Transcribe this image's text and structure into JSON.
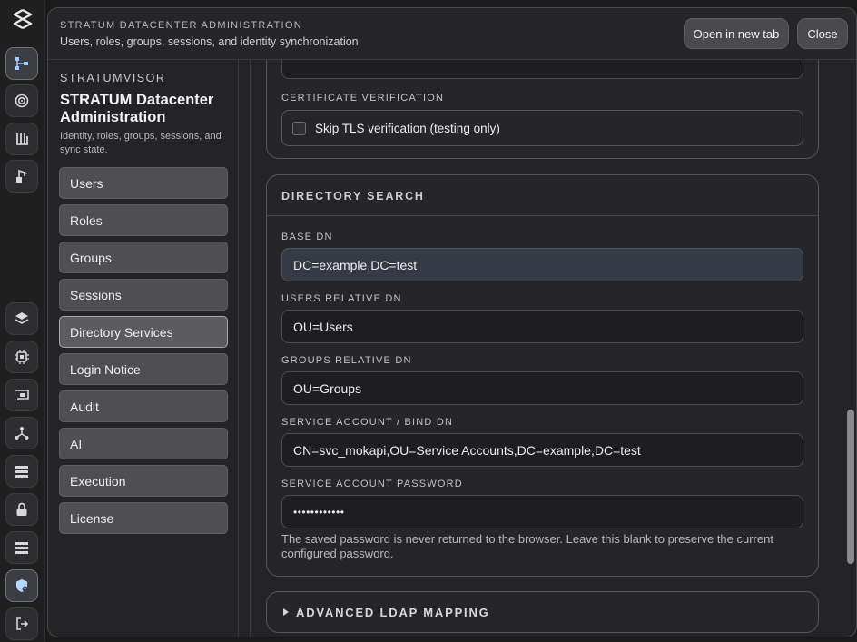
{
  "header": {
    "eyebrow": "STRATUM DATACENTER ADMINISTRATION",
    "subtitle": "Users, roles, groups, sessions, and identity synchronization",
    "open_new_tab_label": "Open in new tab",
    "close_label": "Close"
  },
  "sidebar": {
    "brand": "STRATUMVISOR",
    "title": "STRATUM Datacenter Administration",
    "description": "Identity, roles, groups, sessions, and sync state.",
    "items": [
      {
        "label": "Users"
      },
      {
        "label": "Roles"
      },
      {
        "label": "Groups"
      },
      {
        "label": "Sessions"
      },
      {
        "label": "Directory Services"
      },
      {
        "label": "Login Notice"
      },
      {
        "label": "Audit"
      },
      {
        "label": "AI"
      },
      {
        "label": "Execution"
      },
      {
        "label": "License"
      }
    ],
    "active_item": "Directory Services"
  },
  "certificate": {
    "label": "CERTIFICATE VERIFICATION",
    "skip_tls_label": "Skip TLS verification (testing only)",
    "skip_tls_checked": false
  },
  "directory_search": {
    "title": "DIRECTORY SEARCH",
    "base_dn_label": "BASE DN",
    "base_dn_value": "DC=example,DC=test",
    "users_dn_label": "USERS RELATIVE DN",
    "users_dn_value": "OU=Users",
    "groups_dn_label": "GROUPS RELATIVE DN",
    "groups_dn_value": "OU=Groups",
    "bind_dn_label": "SERVICE ACCOUNT / BIND DN",
    "bind_dn_value": "CN=svc_mokapi,OU=Service Accounts,DC=example,DC=test",
    "password_label": "SERVICE ACCOUNT PASSWORD",
    "password_value": "••••••••••••",
    "password_hint": "The saved password is never returned to the browser. Leave this blank to preserve the current configured password."
  },
  "advanced": {
    "title": "ADVANCED LDAP MAPPING"
  },
  "rail": {
    "icons": [
      "topology-icon",
      "target-icon",
      "rack-icon",
      "crane-icon",
      "layers-icon",
      "chip-icon",
      "gpu-card-icon",
      "network-icon",
      "list-icon",
      "lock-icon",
      "server-list-icon",
      "shield-user-icon",
      "logout-icon"
    ],
    "active_icon": "shield-user-icon"
  }
}
